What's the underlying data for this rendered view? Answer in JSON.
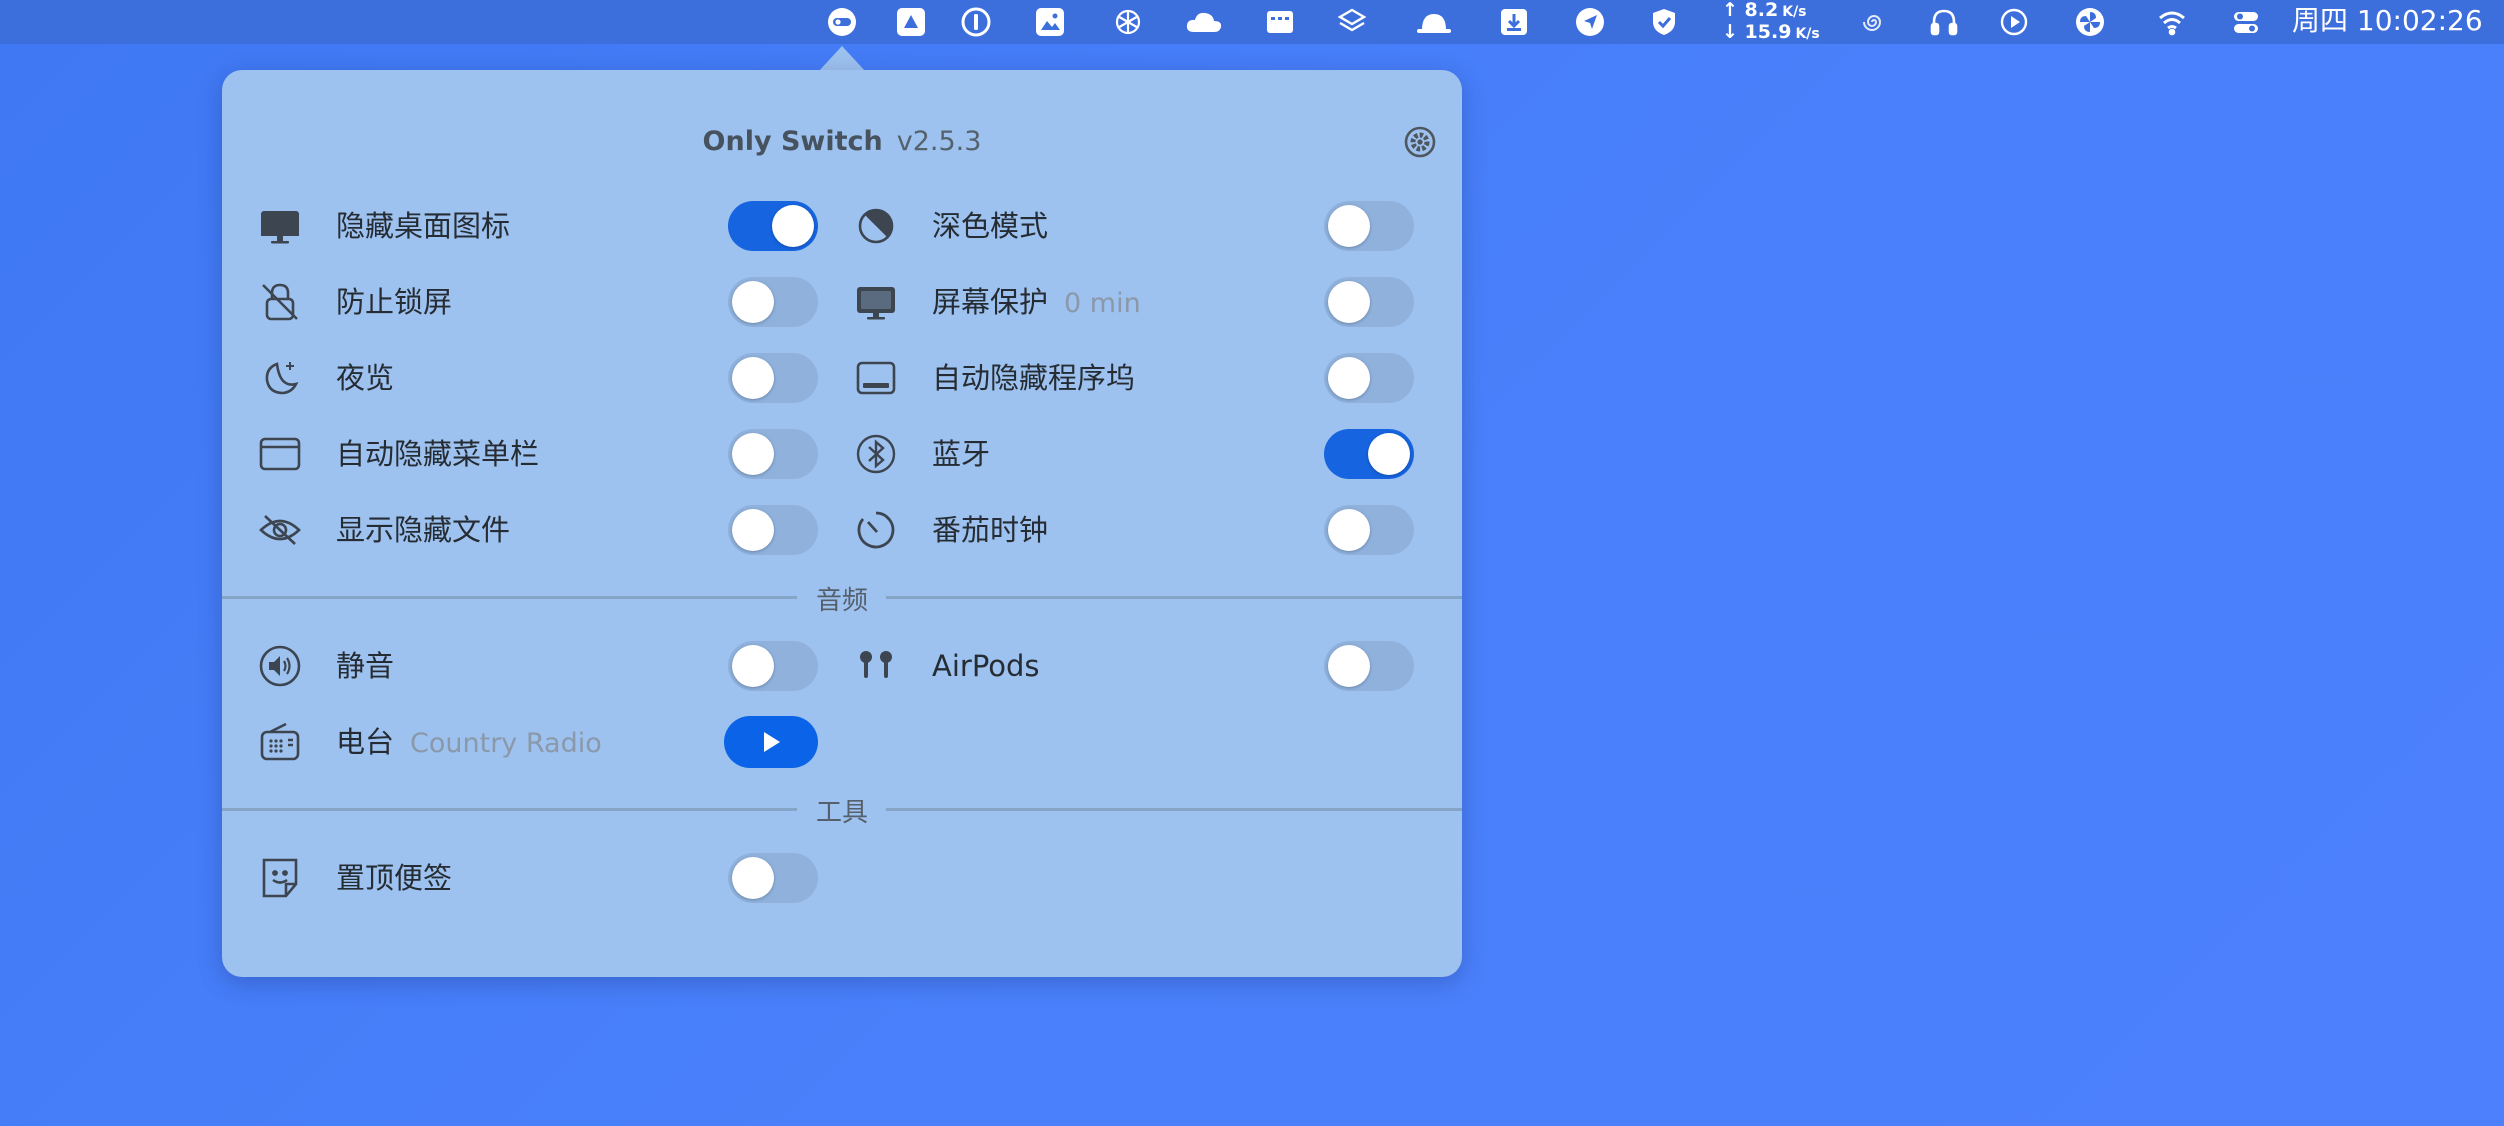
{
  "menubar": {
    "icons": [
      "only-switch-icon",
      "google-drive-icon",
      "onepassword-icon",
      "image-viewer-icon",
      "openai-icon",
      "cloud-icon",
      "window-manager-icon",
      "layers-icon",
      "hat-icon",
      "download-icon",
      "location-arrow-icon",
      "shield-check-icon"
    ],
    "network": {
      "up_value": "8.2",
      "up_unit": "K/s",
      "down_value": "15.9",
      "down_unit": "K/s"
    },
    "right_icons": [
      "spiral-icon",
      "headphones-icon",
      "play-circle-icon",
      "pinwheel-icon",
      "wifi-icon",
      "control-center-icon"
    ],
    "clock": "周四 10:02:26"
  },
  "popover": {
    "app_name": "Only Switch",
    "version": "v2.5.3",
    "settings_icon": "gear-icon",
    "left_column": [
      {
        "label": "隐藏桌面图标",
        "icon": "monitor-icon",
        "on": true
      },
      {
        "label": "防止锁屏",
        "icon": "lock-slash-icon",
        "on": false
      },
      {
        "label": "夜览",
        "icon": "moon-stars-icon",
        "on": false
      },
      {
        "label": "自动隐藏菜单栏",
        "icon": "menubar-window-icon",
        "on": false
      },
      {
        "label": "显示隐藏文件",
        "icon": "eye-slash-icon",
        "on": false
      }
    ],
    "right_column": [
      {
        "label": "深色模式",
        "icon": "dark-mode-icon",
        "on": false
      },
      {
        "label": "屏幕保护",
        "sub": "0 min",
        "icon": "display-icon",
        "on": false
      },
      {
        "label": "自动隐藏程序坞",
        "icon": "dock-icon",
        "on": false
      },
      {
        "label": "蓝牙",
        "icon": "bluetooth-icon",
        "on": true
      },
      {
        "label": "番茄时钟",
        "icon": "timer-icon",
        "on": false
      }
    ],
    "audio_section": {
      "title": "音频",
      "mute": {
        "label": "静音",
        "icon": "speaker-icon",
        "on": false
      },
      "airpods": {
        "label": "AirPods",
        "icon": "airpods-icon",
        "on": false
      },
      "radio": {
        "label": "电台",
        "sub": "Country Radio",
        "icon": "radio-icon",
        "button": "play-icon"
      }
    },
    "tools_section": {
      "title": "工具",
      "sticky": {
        "label": "置顶便签",
        "icon": "sticky-note-icon",
        "on": false
      }
    }
  }
}
